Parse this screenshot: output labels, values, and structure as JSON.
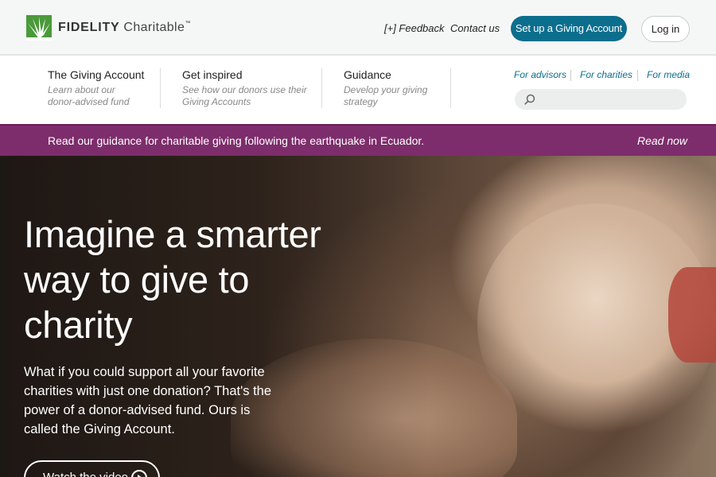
{
  "header": {
    "logo_brand": "FIDELITY",
    "logo_product": "Charitable",
    "logo_tm": "™",
    "feedback": "[+] Feedback",
    "contact": "Contact us",
    "setup_button": "Set up a Giving Account",
    "login_button": "Log in"
  },
  "nav": {
    "items": [
      {
        "title": "The Giving Account",
        "desc_line1": "Learn about our",
        "desc_line2": "donor-advised fund"
      },
      {
        "title": "Get inspired",
        "desc_line1": "See how our donors use their",
        "desc_line2": "Giving Accounts"
      },
      {
        "title": "Guidance",
        "desc_line1": "Develop your giving",
        "desc_line2": "strategy"
      }
    ],
    "audience_links": [
      "For advisors",
      "For charities",
      "For media"
    ],
    "search_placeholder": ""
  },
  "banner": {
    "text": "Read our guidance for charitable giving following the earthquake in Ecuador.",
    "link": "Read now"
  },
  "hero": {
    "title": "Imagine a smarter way to give to charity",
    "subtitle": "What if you could support all your favorite charities with just one donation? That's the power of a donor-advised fund. Ours is called the Giving Account.",
    "video_button": "Watch the video"
  },
  "colors": {
    "brand_green": "#4a9a3a",
    "primary_blue": "#0c6e8d",
    "banner_purple": "#7d2d6b"
  }
}
